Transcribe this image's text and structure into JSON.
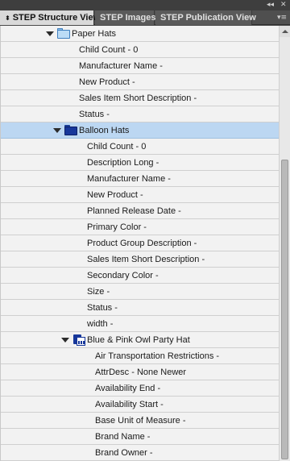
{
  "window": {
    "minimize_glyph": "◂◂",
    "close_glyph": "✕",
    "panel_menu_glyph": "▾≡"
  },
  "tabs": [
    {
      "label": "STEP Structure View",
      "active": true
    },
    {
      "label": "STEP Images",
      "active": false
    },
    {
      "label": "STEP Publication View",
      "active": false
    }
  ],
  "tree": {
    "paper_hats": {
      "label": "Paper Hats",
      "attributes": [
        "Child Count - 0",
        "Manufacturer Name -",
        "New Product -",
        "Sales Item Short Description -",
        "Status -"
      ]
    },
    "balloon_hats": {
      "label": "Balloon Hats",
      "attributes": [
        "Child Count - 0",
        "Description Long -",
        "Manufacturer Name -",
        "New Product -",
        "Planned Release Date -",
        "Primary Color -",
        "Product Group Description -",
        "Sales Item Short Description -",
        "Secondary Color -",
        "Size -",
        "Status -",
        "width -"
      ]
    },
    "owl_hat": {
      "label": "Blue & Pink Owl Party Hat",
      "attributes": [
        "Air Transportation Restrictions -",
        "AttrDesc - None Newer",
        "Availability End -",
        "Availability Start -",
        "Base Unit of Measure -",
        "Brand Name -",
        "Brand Owner -"
      ]
    }
  },
  "colors": {
    "selected_row": "#bcd7f2",
    "folder_light": "#bcdcf6",
    "folder_dark": "#17379a"
  }
}
